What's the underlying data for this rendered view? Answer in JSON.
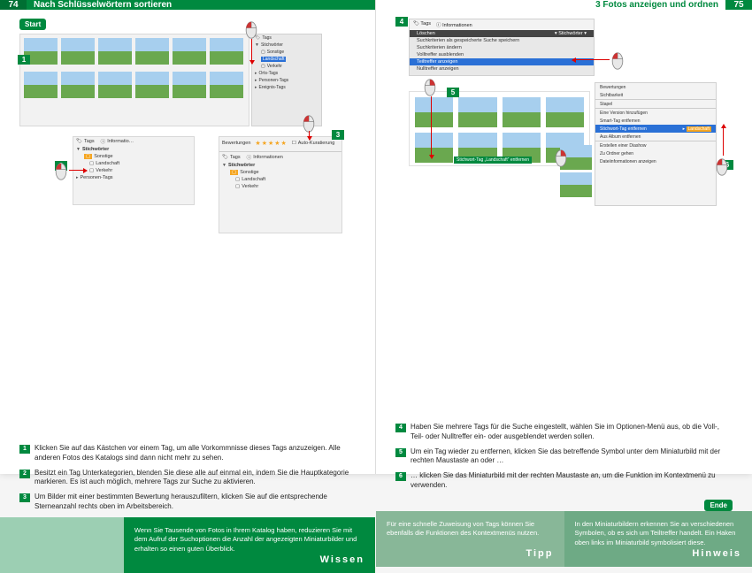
{
  "left": {
    "page_num": "74",
    "chapter": "Nach Schlüsselwörtern sortieren",
    "start": "Start",
    "steps": [
      {
        "n": "1",
        "text": "Klicken Sie auf das Kästchen vor einem Tag, um alle Vorkommnisse dieses Tags anzuzeigen. Alle anderen Fotos des Katalogs sind dann nicht mehr zu sehen."
      },
      {
        "n": "2",
        "text": "Besitzt ein Tag Unterkategorien, blenden Sie diese alle auf einmal ein, indem Sie die Hauptkategorie markieren. Es ist auch möglich, mehrere Tags zur Suche zu aktivieren."
      },
      {
        "n": "3",
        "text": "Um Bilder mit einer bestimmten Bewertung herauszufiltern, klicken Sie auf die entsprechende Sterneanzahl rechts oben im Arbeitsbereich."
      }
    ],
    "wissen": {
      "label": "Wissen",
      "text": "Wenn Sie Tausende von Fotos in Ihrem Katalog haben, reduzieren Sie mit dem Aufruf der Suchoptionen die Anzahl der angezeigten Miniaturbilder und erhalten so einen guten Überblick."
    },
    "fig2_panel": {
      "tags_label": "Tags",
      "info_label": "Informatio…",
      "items": [
        "Stichwörter",
        "Sonstige",
        "Landschaft",
        "Verkehr",
        "Personen-Tags"
      ]
    },
    "fig3_panel": {
      "bewertungen": "Bewertungen",
      "stars": "★★★★★",
      "auto": "Auto-Kuratierung",
      "tags_label": "Tags",
      "info_label": "Informationen",
      "items": [
        "Stichwörter",
        "Sonstige",
        "Landschaft",
        "Verkehr"
      ]
    },
    "sidepanel": {
      "tags": "Tags",
      "items": [
        "Stichwörter",
        "Sonstige",
        "Landschaft",
        "Verkehr",
        "Orts-Tags",
        "Personen-Tags",
        "Ereignis-Tags"
      ]
    }
  },
  "right": {
    "page_num": "75",
    "chapter": "3  Fotos anzeigen und ordnen",
    "end": "Ende",
    "steps": [
      {
        "n": "4",
        "text": "Haben Sie mehrere Tags für die Suche eingestellt, wählen Sie im Optionen-Menü aus, ob die Voll-, Teil- oder Nulltreffer ein- oder ausgeblendet werden sollen."
      },
      {
        "n": "5",
        "text": "Um ein Tag wieder zu entfernen, klicken Sie das betreffende Symbol unter dem Miniaturbild mit der rechten Maustaste an oder …"
      },
      {
        "n": "6",
        "text": "… klicken Sie das Miniaturbild mit der rechten Maustaste an, um die Funktion im Kontextmenü zu verwenden."
      }
    ],
    "fig4_menu": {
      "toolbar": [
        "Tags",
        "Informationen"
      ],
      "dropdown": "Stichwörter",
      "loeschen": "Löschen",
      "items": [
        "Suchkriterien als gespeicherte Suche speichern",
        "Suchkriterien ändern",
        "Volltreffer ausblenden",
        "Teiltreffer anzeigen",
        "Nulltreffer anzeigen"
      ],
      "selected_idx": 3
    },
    "fig6_ctx": {
      "items": [
        "Bewertungen",
        "Sichtbarkeit",
        "Stapel",
        "Eine Version hinzufügen",
        "Smart-Tag entfernen",
        "Stichwort-Tag entfernen",
        "Aus Album entfernen",
        "Erstellen einer Diashow",
        "Zu Ordner gehen",
        "Dateiinformationen anzeigen"
      ],
      "selected_idx": 5,
      "sub_label": "Landschaft"
    },
    "thumb_label": "Stichwort-Tag „Landschaft“ entfernen",
    "tipp": {
      "label": "Tipp",
      "text": "Für eine schnelle Zuweisung von Tags können Sie ebenfalls die Funktionen des Kontextmenüs nutzen."
    },
    "hinweis": {
      "label": "Hinweis",
      "text": "In den Miniaturbildern erkennen Sie an verschiedenen Symbolen, ob es sich um Teiltreffer handelt. Ein Haken oben links im Miniaturbild symbolisiert diese."
    }
  },
  "icons": {
    "mouse": "mouse-icon"
  }
}
